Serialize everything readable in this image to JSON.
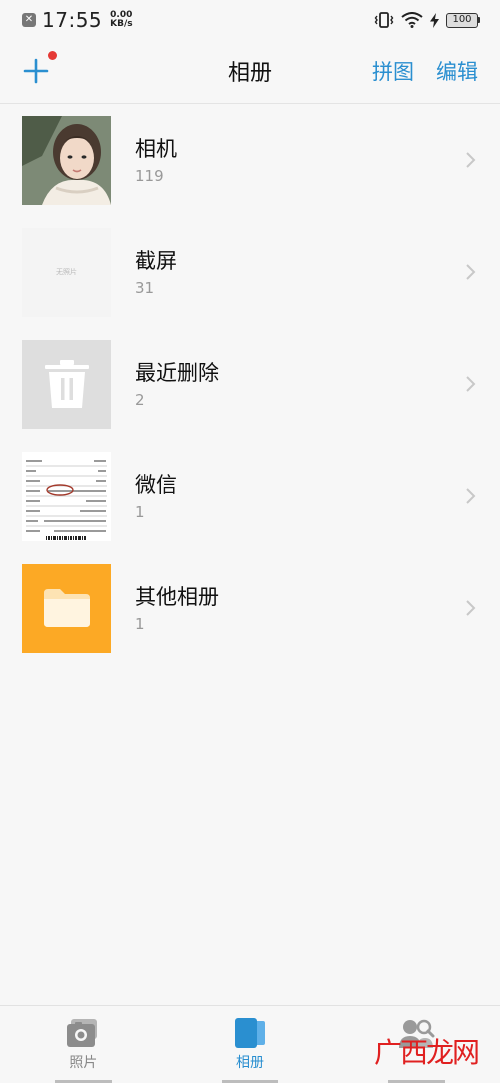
{
  "status_bar": {
    "time": "17:55",
    "netspeed_value": "0.00",
    "netspeed_unit": "KB/s",
    "battery": "100"
  },
  "header": {
    "title": "相册",
    "actions": [
      "拼图",
      "编辑"
    ]
  },
  "albums": [
    {
      "name": "相机",
      "count": "119"
    },
    {
      "name": "截屏",
      "count": "31",
      "thumb_text": "无照片"
    },
    {
      "name": "最近删除",
      "count": "2"
    },
    {
      "name": "微信",
      "count": "1"
    },
    {
      "name": "其他相册",
      "count": "1"
    }
  ],
  "bottom_nav": {
    "tabs": [
      {
        "label": "照片",
        "icon": "photos-icon"
      },
      {
        "label": "相册",
        "icon": "albums-icon"
      },
      {
        "label": "",
        "icon": "people-icon"
      }
    ],
    "active": "相册"
  },
  "watermark": "广西龙网",
  "colors": {
    "accent": "#2a8fd0",
    "badge": "#e53935",
    "folder": "#fca925"
  }
}
